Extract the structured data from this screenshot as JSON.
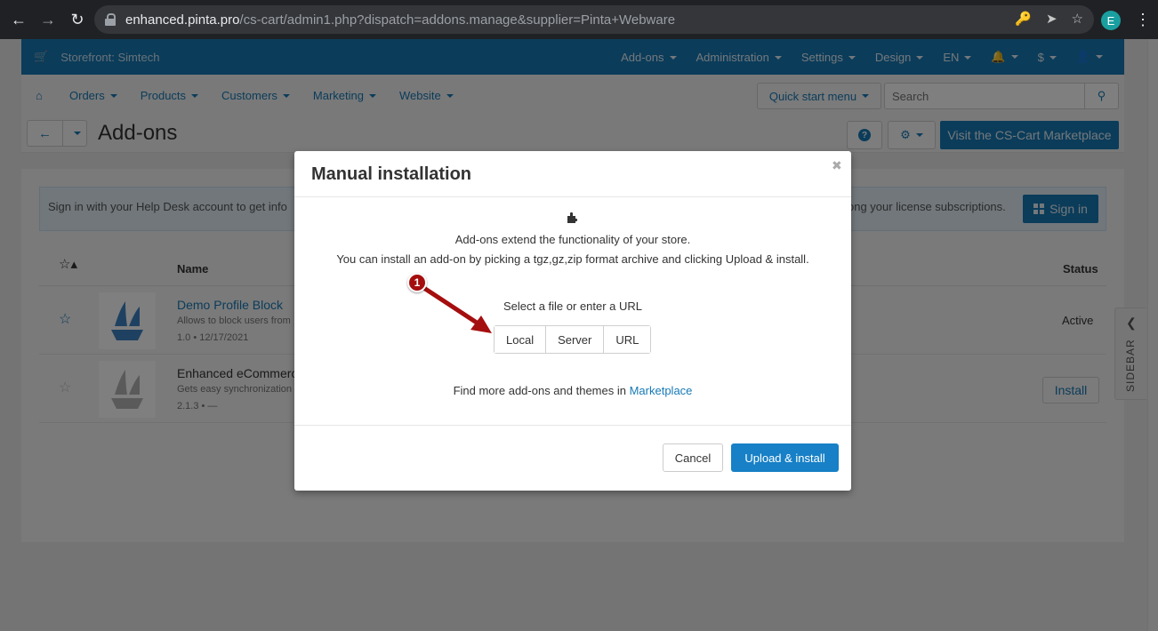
{
  "browser": {
    "url_host": "enhanced.pinta.pro",
    "url_rest": "/cs-cart/admin1.php?dispatch=addons.manage&supplier=Pinta+Webware",
    "profile_initial": "E"
  },
  "topbar": {
    "storefront": "Storefront: Simtech",
    "menu": [
      "Add-ons",
      "Administration",
      "Settings",
      "Design",
      "EN",
      "$"
    ]
  },
  "nav": {
    "items": [
      "Orders",
      "Products",
      "Customers",
      "Marketing",
      "Website"
    ],
    "quick_start": "Quick start menu",
    "search_placeholder": "Search"
  },
  "page": {
    "title": "Add-ons",
    "marketplace_button": "Visit the CS-Cart Marketplace"
  },
  "notice": {
    "text_left": "Sign in with your Help Desk account to get info",
    "text_right": "ong your license subscriptions.",
    "sign_in": "Sign in"
  },
  "table": {
    "header_name": "Name",
    "header_status": "Status",
    "rows": [
      {
        "name": "Demo Profile Block",
        "desc": "Allows to block users from",
        "meta": "1.0 • 12/17/2021",
        "status": "Active"
      },
      {
        "name": "Enhanced eCommerce",
        "desc": "Gets easy synchronization",
        "meta": "2.1.3 • —",
        "action": "Install"
      }
    ]
  },
  "sidebar": {
    "label": "SIDEBAR"
  },
  "modal": {
    "title": "Manual installation",
    "line1": "Add-ons extend the functionality of your store.",
    "line2": "You can install an add-on by picking a tgz,gz,zip format archive and clicking Upload & install.",
    "select_label": "Select a file or enter a URL",
    "sources": [
      "Local",
      "Server",
      "URL"
    ],
    "find_more": "Find more add-ons and themes in",
    "marketplace_link": "Marketplace",
    "cancel": "Cancel",
    "upload": "Upload & install"
  },
  "annotation": {
    "step": "1"
  },
  "colors": {
    "accent": "#1779b5",
    "primary_button": "#1780c6",
    "annotation": "#a50e0e"
  }
}
